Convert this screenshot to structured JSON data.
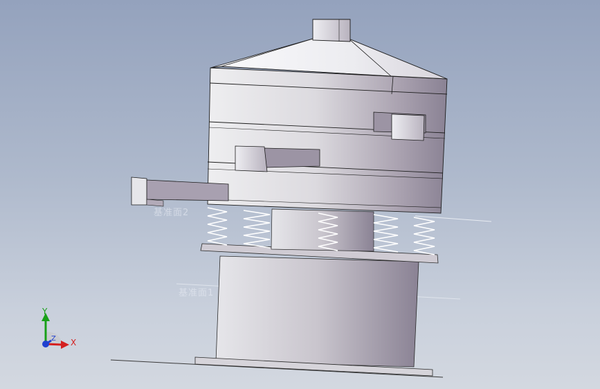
{
  "viewport": {
    "background_top": "#94a2bd",
    "background_bottom": "#d3d8e0"
  },
  "model": {
    "colors": {
      "body_light": "#f2f2f4",
      "body_dark": "#8b8394",
      "edge": "#1c1c1c",
      "spring": "#ffffff"
    }
  },
  "ghost_labels": {
    "upper_plane": "基准面2",
    "lower_plane": "基准面1"
  },
  "triad": {
    "x_label": "X",
    "y_label": "Y",
    "z_label": "Z",
    "x_color": "#d42020",
    "y_color": "#18a018",
    "z_color": "#2040d0"
  }
}
